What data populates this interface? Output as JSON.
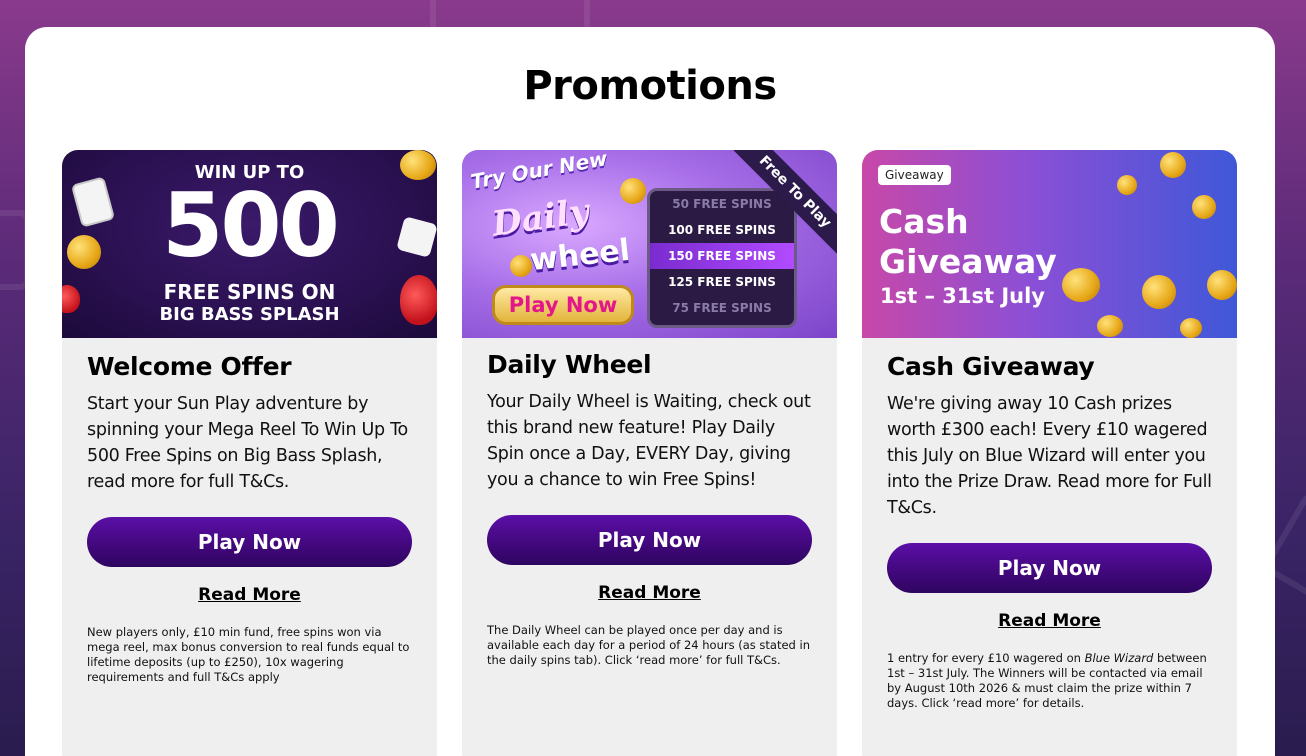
{
  "page": {
    "title": "Promotions"
  },
  "cards": [
    {
      "title": "Welcome Offer",
      "description": "Start your Sun Play adventure by spinning your Mega Reel To Win Up To 500 Free Spins on Big Bass Splash, read more for full T&Cs.",
      "play_label": "Play Now",
      "read_more_label": "Read More",
      "terms": "New players only, £10 min fund, free spins won via mega reel, max bonus conversion to real funds equal to lifetime deposits (up to £250), 10x wagering requirements and full T&Cs apply",
      "banner": {
        "line1": "WIN UP TO",
        "line2": "500",
        "line3": "FREE SPINS ON",
        "line4": "BIG BASS SPLASH"
      }
    },
    {
      "title": "Daily Wheel",
      "description": "Your Daily Wheel is Waiting, check out this brand new feature! Play Daily Spin once a Day, EVERY Day, giving you a chance to win Free Spins!",
      "play_label": "Play Now",
      "read_more_label": "Read More",
      "terms": "The Daily Wheel can be played once per day and is available each day for a period of 24 hours (as stated in the daily spins tab). Click ‘read more’ for full T&Cs.",
      "banner": {
        "try": "Try Our New",
        "daily": "Daily",
        "wheel": "wheel",
        "play": "Play Now",
        "ribbon": "Free To Play",
        "reel": [
          "50 FREE SPINS",
          "100 FREE SPINS",
          "150 FREE SPINS",
          "125 FREE SPINS",
          "75 FREE SPINS"
        ]
      }
    },
    {
      "title": "Cash Giveaway",
      "description": "We're giving away 10 Cash prizes worth £300 each! Every £10 wagered this July on Blue Wizard will enter you into the Prize Draw. Read more for Full T&Cs.",
      "play_label": "Play Now",
      "read_more_label": "Read More",
      "terms_a": "1 entry for every £10 wagered on ",
      "terms_b": "Blue Wizard",
      "terms_c": " between 1st – 31st July. The Winners will be contacted via email by August 10th 2026 & must claim the prize within 7 days. Click ‘read more’ for details.",
      "banner": {
        "tag": "Giveaway",
        "line1": "Cash",
        "line2": "Giveaway",
        "line3": "1st – 31st July"
      }
    }
  ],
  "colors": {
    "button": "#4a0a8a",
    "panel": "#ffffff",
    "card": "#efefef"
  }
}
